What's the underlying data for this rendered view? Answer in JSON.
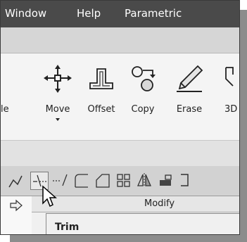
{
  "menubar": {
    "items": [
      "Window",
      "Help",
      "Parametric"
    ]
  },
  "side_fragment": "le",
  "modify_panel": {
    "tools": [
      {
        "label": "Move",
        "icon": "move-icon",
        "has_dropdown": true
      },
      {
        "label": "Offset",
        "icon": "offset-icon"
      },
      {
        "label": "Copy",
        "icon": "copy-icon"
      },
      {
        "label": "Erase",
        "icon": "erase-icon"
      },
      {
        "label": "3D",
        "icon": "3d-icon"
      }
    ],
    "small_tools": [
      "trim-icon",
      "extend-icon",
      "fillet-icon",
      "chamfer-icon",
      "array-icon",
      "mirror-icon",
      "stretch-icon",
      "explode-icon"
    ],
    "title": "Modify"
  },
  "tooltip": {
    "title": "Trim"
  }
}
